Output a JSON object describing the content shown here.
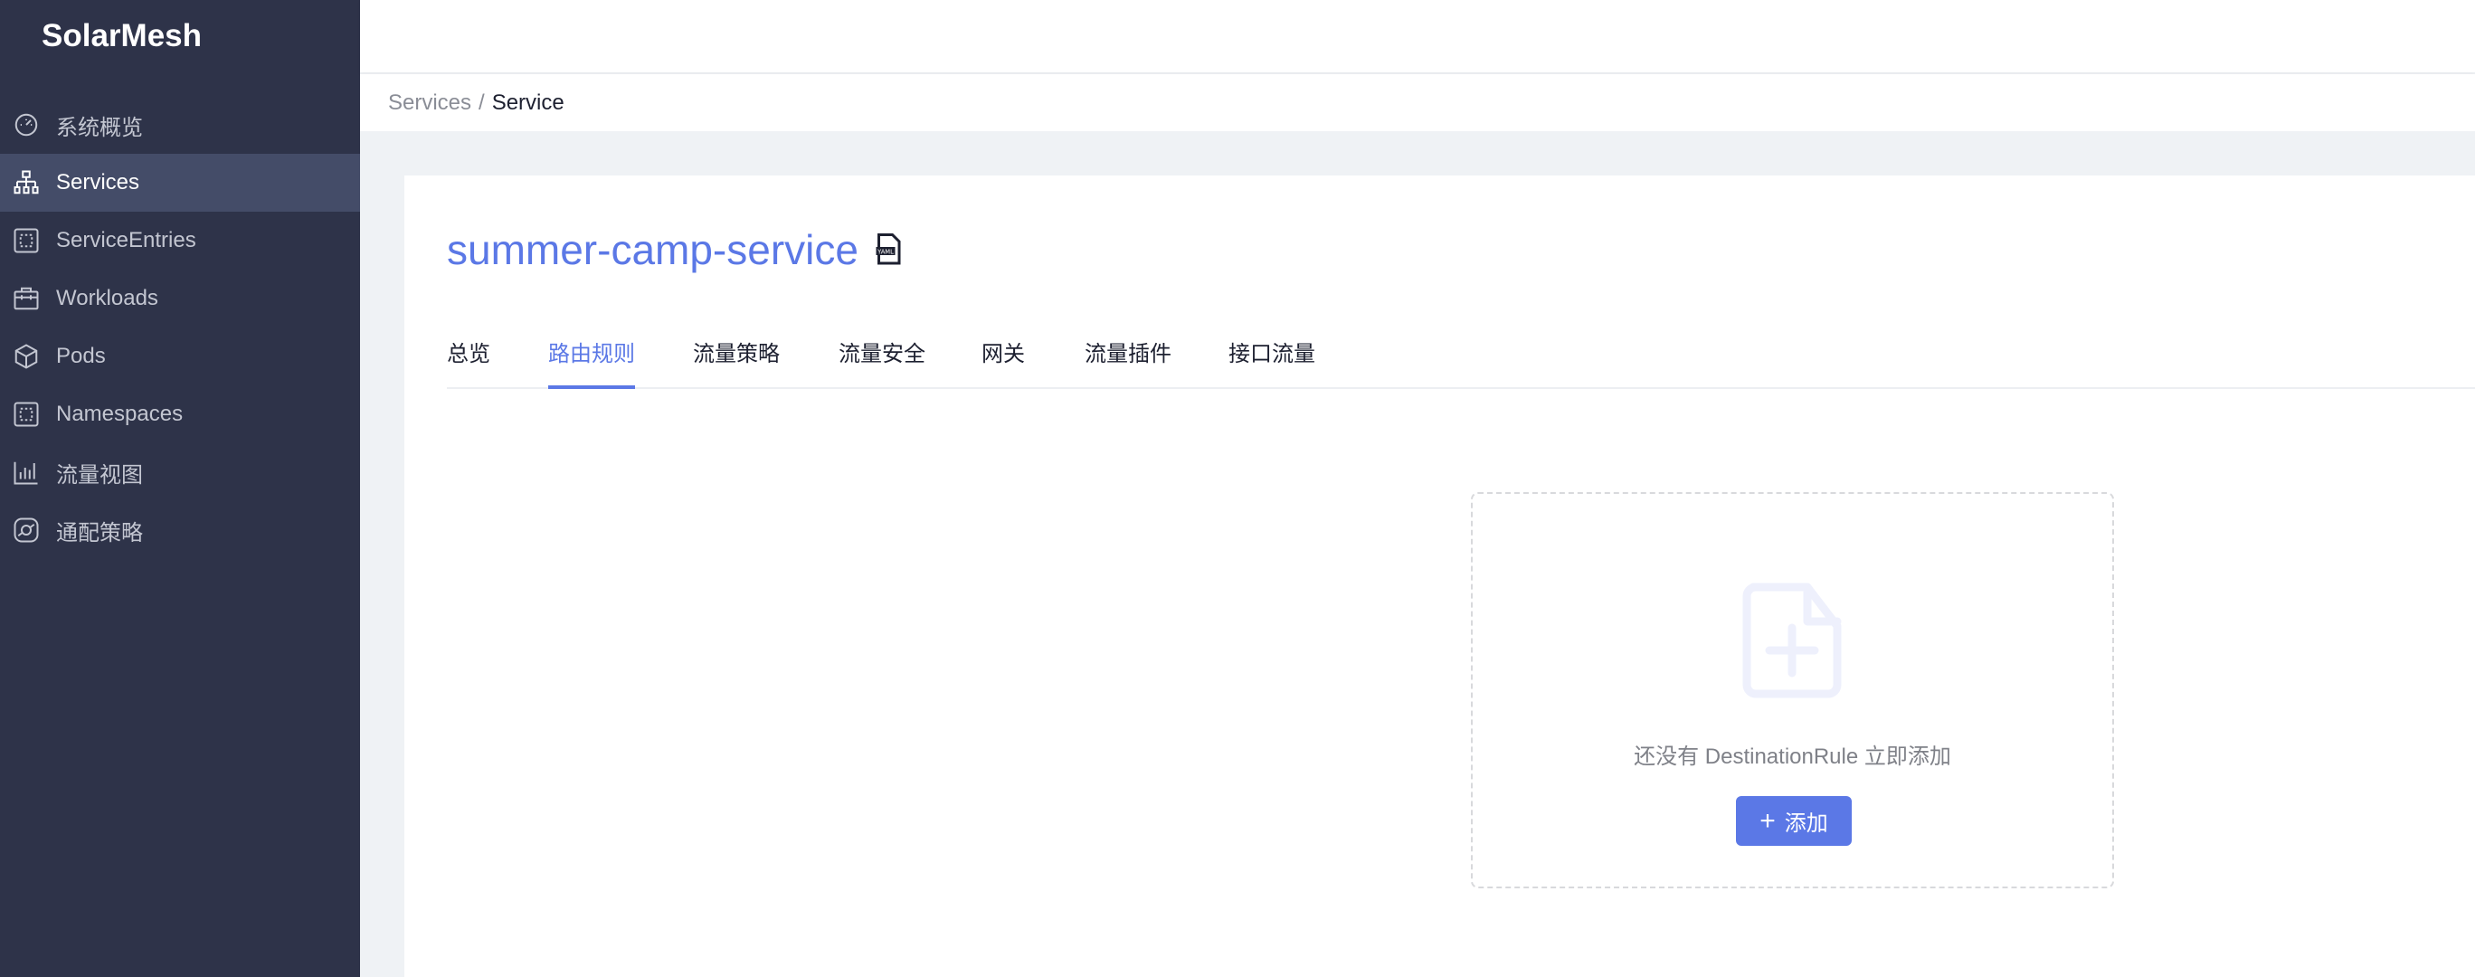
{
  "app": {
    "logo": "SolarMesh"
  },
  "sidebar": {
    "items": [
      {
        "label": "系统概览",
        "icon": "dashboard-icon"
      },
      {
        "label": "Services",
        "icon": "sitemap-icon",
        "active": true
      },
      {
        "label": "ServiceEntries",
        "icon": "dashed-square-icon"
      },
      {
        "label": "Workloads",
        "icon": "briefcase-icon"
      },
      {
        "label": "Pods",
        "icon": "cube-icon"
      },
      {
        "label": "Namespaces",
        "icon": "dashed-square-icon"
      },
      {
        "label": "流量视图",
        "icon": "bar-chart-icon"
      },
      {
        "label": "通配策略",
        "icon": "policy-icon"
      }
    ]
  },
  "breadcrumb": {
    "parent": "Services",
    "separator": "/",
    "current": "Service"
  },
  "page": {
    "title": "summer-camp-service",
    "yaml_icon": "yaml-file-icon",
    "yaml_label": "YAML"
  },
  "tabs": [
    {
      "label": "总览"
    },
    {
      "label": "路由规则",
      "active": true
    },
    {
      "label": "流量策略"
    },
    {
      "label": "流量安全"
    },
    {
      "label": "网关"
    },
    {
      "label": "流量插件"
    },
    {
      "label": "接口流量"
    }
  ],
  "empty_state": {
    "icon": "file-add-icon",
    "message": "还没有 DestinationRule 立即添加",
    "button_label": "添加",
    "button_icon": "plus-icon"
  },
  "colors": {
    "accent": "#5b78e6",
    "sidebar": "#2e3349",
    "sidebar_active": "#444c68"
  }
}
